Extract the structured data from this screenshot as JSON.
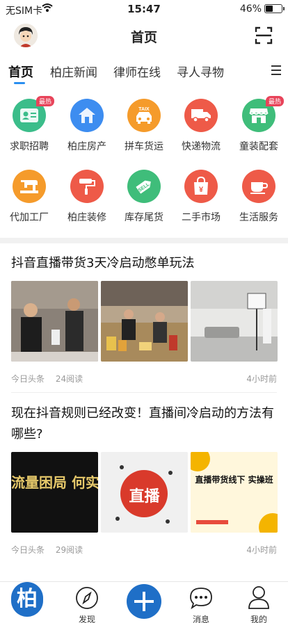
{
  "status_bar": {
    "carrier": "无SIM卡",
    "time": "15:47",
    "battery_percent_text": "46%",
    "battery_level": 0.46
  },
  "nav": {
    "title": "首页"
  },
  "tabs": [
    {
      "label": "首页",
      "active": true
    },
    {
      "label": "柏庄新闻",
      "active": false
    },
    {
      "label": "律师在线",
      "active": false
    },
    {
      "label": "寻人寻物",
      "active": false
    }
  ],
  "categories": [
    {
      "label": "求职招聘",
      "icon": "id-card-icon",
      "color": "#3bbd8a",
      "badge": "最热"
    },
    {
      "label": "柏庄房产",
      "icon": "house-icon",
      "color": "#3d8df0",
      "badge": ""
    },
    {
      "label": "拼车货运",
      "icon": "taxi-icon",
      "color": "#f59b2b",
      "badge": ""
    },
    {
      "label": "快递物流",
      "icon": "truck-icon",
      "color": "#ee5a48",
      "badge": ""
    },
    {
      "label": "童装配套",
      "icon": "shop-icon",
      "color": "#3fbd7a",
      "badge": "最热"
    },
    {
      "label": "代加工厂",
      "icon": "sewing-machine-icon",
      "color": "#f59b2b",
      "badge": ""
    },
    {
      "label": "柏庄装修",
      "icon": "paint-roller-icon",
      "color": "#ee5a48",
      "badge": ""
    },
    {
      "label": "库存尾货",
      "icon": "sell-tag-icon",
      "color": "#3fbd7a",
      "badge": ""
    },
    {
      "label": "二手市场",
      "icon": "shopping-bag-icon",
      "color": "#ee5a48",
      "badge": ""
    },
    {
      "label": "生活服务",
      "icon": "coffee-cup-icon",
      "color": "#ee5a48",
      "badge": ""
    }
  ],
  "icon_text": {
    "taxi": "TAIX",
    "sell": "SELL",
    "yen": "¥"
  },
  "articles": [
    {
      "title": "抖音直播带货3天冷启动憋单玩法",
      "source": "今日头条",
      "reads": "24阅读",
      "time": "4小时前",
      "thumb_captions": [
        "",
        "",
        ""
      ]
    },
    {
      "title": "现在抖音规则已经改变！直播间冷启动的方法有哪些?",
      "source": "今日头条",
      "reads": "29阅读",
      "time": "4小时前",
      "thumb_captions": [
        "流量困局 何实现增长破局",
        "直播",
        "直播带货线下 实操班"
      ]
    }
  ],
  "tabbar": {
    "items": [
      {
        "label": "",
        "icon": "brand-logo-icon"
      },
      {
        "label": "发现",
        "icon": "compass-icon"
      },
      {
        "label": "",
        "icon": "plus-icon"
      },
      {
        "label": "消息",
        "icon": "chat-icon"
      },
      {
        "label": "我的",
        "icon": "user-icon"
      }
    ],
    "logo_char": "柏"
  },
  "colors": {
    "accent": "#2a8ff0",
    "hot": "#e8445a"
  }
}
